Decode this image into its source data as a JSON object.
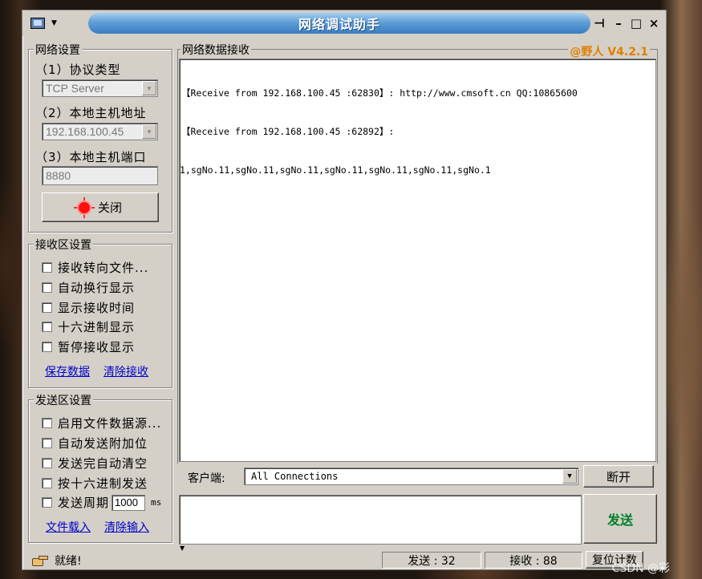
{
  "window": {
    "title": "网络调试助手",
    "version": "@野人 V4.2.1"
  },
  "net_settings": {
    "group_label": "网络设置",
    "protocol_label": "（1）协议类型",
    "protocol_value": "TCP Server",
    "host_label": "（2）本地主机地址",
    "host_value": "192.168.100.45",
    "port_label": "（3）本地主机端口",
    "port_value": "8880",
    "close_button": "关闭"
  },
  "recv_settings": {
    "group_label": "接收区设置",
    "options": [
      "接收转向文件...",
      "自动换行显示",
      "显示接收时间",
      "十六进制显示",
      "暂停接收显示"
    ],
    "save_link": "保存数据",
    "clear_link": "清除接收"
  },
  "send_settings": {
    "group_label": "发送区设置",
    "options": [
      "启用文件数据源...",
      "自动发送附加位",
      "发送完自动清空",
      "按十六进制发送"
    ],
    "period_label": "发送周期",
    "period_value": "1000",
    "period_unit": "ms",
    "load_link": "文件载入",
    "clear_input_link": "清除输入"
  },
  "recv_area": {
    "label": "网络数据接收",
    "lines": [
      "【Receive from 192.168.100.45 :62830】: http://www.cmsoft.cn QQ:10865600",
      "【Receive from 192.168.100.45 :62892】:",
      "1,sgNo.11,sgNo.11,sgNo.11,sgNo.11,sgNo.11,sgNo.11,sgNo.1"
    ]
  },
  "client": {
    "label": "客户端:",
    "selected": "All Connections",
    "disconnect_button": "断开"
  },
  "send_button": "发送",
  "status": {
    "ready": "就绪!",
    "sent_label": "发送 : 32",
    "recv_label": "接收 : 88",
    "reset_button": "复位计数",
    "colors": {
      "send_text": "#00802a",
      "version_text": "#e08000"
    }
  },
  "watermark": "CSDN @彩"
}
